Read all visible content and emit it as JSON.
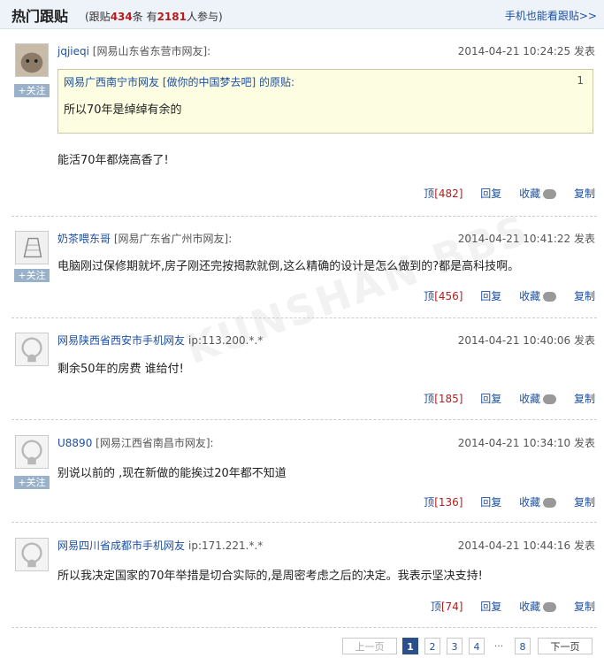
{
  "header": {
    "title": "热门跟贴",
    "stats_prefix": "(跟贴",
    "count": "434",
    "stats_mid": "条 有",
    "participants": "2181",
    "stats_suffix": "人参与)",
    "mobile_link": "手机也能看跟贴>>"
  },
  "posts": [
    {
      "user": "jqjieqi",
      "location": "[网易山东省东营市网友]:",
      "time": "2014-04-21 10:24:25 发表",
      "follow": "+关注",
      "quote": {
        "head": "网易广西南宁市网友 [做你的中国梦去吧] 的原贴:",
        "num": "1",
        "text": "所以70年是绰绰有余的"
      },
      "text": "能活70年都烧高香了!",
      "up_label": "顶",
      "up_count": "[482]",
      "reply": "回复",
      "fav": "收藏",
      "copy": "复制"
    },
    {
      "user": "奶茶喂东哥",
      "location": "[网易广东省广州市网友]:",
      "time": "2014-04-21 10:41:22 发表",
      "follow": "+关注",
      "text": "电脑刚过保修期就坏,房子刚还完按揭款就倒,这么精确的设计是怎么做到的?都是高科技啊。",
      "up_label": "顶",
      "up_count": "[456]",
      "reply": "回复",
      "fav": "收藏",
      "copy": "复制"
    },
    {
      "user": "网易陕西省西安市手机网友",
      "ip": "ip:113.200.*.*",
      "time": "2014-04-21 10:40:06 发表",
      "text": "剩余50年的房费 谁给付!",
      "up_label": "顶",
      "up_count": "[185]",
      "reply": "回复",
      "fav": "收藏",
      "copy": "复制"
    },
    {
      "user": "U8890",
      "location": "[网易江西省南昌市网友]:",
      "time": "2014-04-21 10:34:10 发表",
      "follow": "+关注",
      "text": "别说以前的 ,现在新做的能挨过20年都不知道",
      "up_label": "顶",
      "up_count": "[136]",
      "reply": "回复",
      "fav": "收藏",
      "copy": "复制"
    },
    {
      "user": "网易四川省成都市手机网友",
      "ip": "ip:171.221.*.*",
      "time": "2014-04-21 10:44:16 发表",
      "text": "所以我决定国家的70年举措是切合实际的,是周密考虑之后的决定。我表示坚决支持!",
      "up_label": "顶",
      "up_count": "[74]",
      "reply": "回复",
      "fav": "收藏",
      "copy": "复制"
    }
  ],
  "pager": {
    "prev": "上一页",
    "pages": [
      "1",
      "2",
      "3",
      "4"
    ],
    "ellipsis": "···",
    "last": "8",
    "next": "下一页"
  },
  "watermark": "KUNSHAN BBS"
}
